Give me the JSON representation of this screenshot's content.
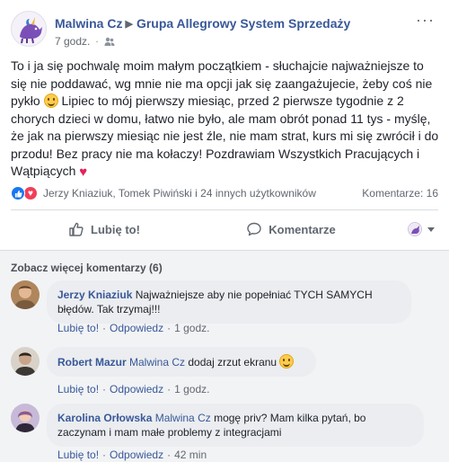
{
  "post": {
    "author": "Malwina Cz",
    "group": "Grupa Allegrowy System Sprzedaży",
    "time": "7 godz.",
    "text_part1": "To i ja się pochwalę moim małym początkiem - słuchajcie najważniejsze to się nie poddawać, wg mnie nie ma opcji jak się zaangażujecie, żeby coś nie pykło ",
    "text_part2": " Lipiec to mój pierwszy miesiąc, przed 2 pierwsze tygodnie z 2 chorych dzieci w domu, łatwo nie było, ale mam obrót ponad 11 tys - myślę, że jak na pierwszy miesiąc nie jest źle, nie mam strat, kurs mi się zwrócił i do przodu! Bez pracy nie ma kołaczy! Pozdrawiam Wszystkich Pracujących i Wątpiących ",
    "reactors": "Jerzy Kniaziuk, Tomek Piwiński i 24 innych użytkowników",
    "comments_count": "Komentarze: 16"
  },
  "actions": {
    "like": "Lubię to!",
    "comment": "Komentarze"
  },
  "comments": {
    "view_more": "Zobacz więcej komentarzy (6)",
    "items": [
      {
        "name": "Jerzy Kniaziuk",
        "tag": "",
        "text": "Najważniejsze aby nie popełniać TYCH SAMYCH błędów. Tak trzymaj!!!",
        "like": "Lubię to!",
        "reply": "Odpowiedz",
        "time": "1 godz."
      },
      {
        "name": "Robert Mazur",
        "tag": "Malwina Cz",
        "text": "dodaj zrzut ekranu",
        "like": "Lubię to!",
        "reply": "Odpowiedz",
        "time": "1 godz."
      },
      {
        "name": "Karolina Orłowska",
        "tag": "Malwina Cz",
        "text": "mogę priv? Mam kilka pytań, bo zaczynam i mam małe problemy z integracjami",
        "like": "Lubię to!",
        "reply": "Odpowiedz",
        "time": "42 min"
      }
    ]
  },
  "icons": {
    "settings": "group-privacy-icon",
    "like": "thumbs-up-icon",
    "comment": "speech-bubble-icon",
    "love": "heart-icon",
    "smile": "smile-emoji-icon"
  },
  "colors": {
    "link": "#385898",
    "like_blue": "#1877f2",
    "love_red": "#f33e58",
    "comments_bg": "#f2f3f5"
  }
}
